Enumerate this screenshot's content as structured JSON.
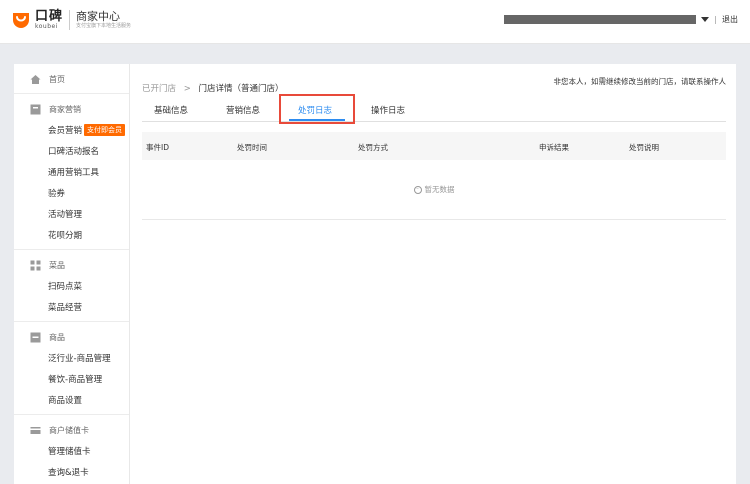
{
  "header": {
    "logo_cn": "口碑",
    "logo_en": "koubei",
    "center_title": "商家中心",
    "center_sub": "支付宝旗下本地生活服务",
    "logout": "退出",
    "separator": "|"
  },
  "sidebar": {
    "groups": [
      {
        "label": "首页",
        "items": []
      },
      {
        "label": "商家营销",
        "items": [
          "会员营销",
          "口碑活动报名",
          "通用营销工具",
          "验券",
          "活动管理",
          "花呗分期"
        ],
        "tag": "支付即会员"
      },
      {
        "label": "菜品",
        "items": [
          "扫码点菜",
          "菜品经营"
        ]
      },
      {
        "label": "商品",
        "items": [
          "泛行业-商品管理",
          "餐饮-商品管理",
          "商品设置"
        ]
      },
      {
        "label": "商户储值卡",
        "items": [
          "管理储值卡",
          "查询&退卡"
        ]
      }
    ]
  },
  "breadcrumb": {
    "parent": "已开门店",
    "sep": ">",
    "current": "门店详情（普通门店）"
  },
  "notice": "非您本人，如需继续修改当前的门店，请联系操作人",
  "tabs": [
    "基础信息",
    "营销信息",
    "处罚日志",
    "操作日志"
  ],
  "active_tab": "处罚日志",
  "table": {
    "columns": [
      "事件ID",
      "处罚时间",
      "处罚方式",
      "申诉结果",
      "处罚说明"
    ],
    "empty_text": "暂无数据"
  },
  "colors": {
    "brand": "#ff6a00",
    "active_tab": "#2d8cf0",
    "highlight": "#e84a3a"
  }
}
